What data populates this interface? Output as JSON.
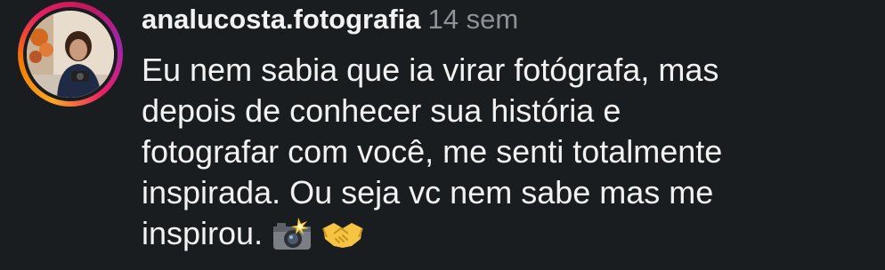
{
  "comment": {
    "username": "analucosta.fotografia",
    "timestamp": "14 sem",
    "text_lines": [
      "Eu nem sabia que ia virar fotógrafa, mas",
      "depois de conhecer sua história e",
      "fotografar com você, me senti totalmente",
      "inspirada. Ou seja vc nem sabe mas me",
      "inspirou."
    ],
    "emojis": [
      "camera-with-flash-icon",
      "handshake-icon"
    ],
    "avatar_ring_colors": [
      "#f9a825",
      "#e91e63",
      "#9c27b0"
    ]
  }
}
